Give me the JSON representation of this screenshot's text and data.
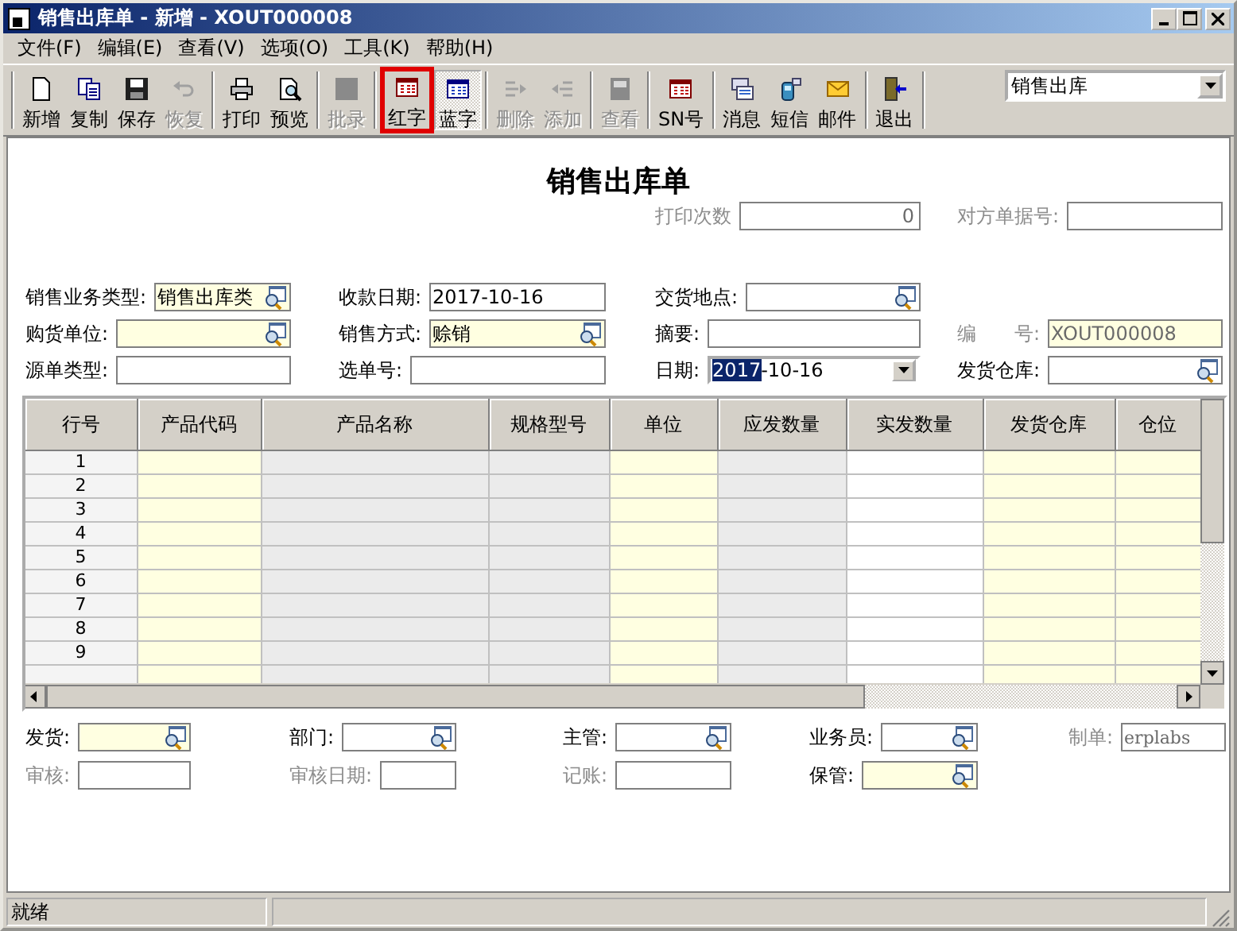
{
  "window": {
    "title": "销售出库单 - 新增 - XOUT000008"
  },
  "menu": [
    "文件(F)",
    "编辑(E)",
    "查看(V)",
    "选项(O)",
    "工具(K)",
    "帮助(H)"
  ],
  "toolbar": {
    "groups": [
      [
        {
          "label": "新增",
          "disabled": false,
          "pressed": false,
          "highlighted": false
        },
        {
          "label": "复制",
          "disabled": false,
          "pressed": false,
          "highlighted": false
        },
        {
          "label": "保存",
          "disabled": false,
          "pressed": false,
          "highlighted": false
        },
        {
          "label": "恢复",
          "disabled": true,
          "pressed": false,
          "highlighted": false
        }
      ],
      [
        {
          "label": "打印",
          "disabled": false,
          "pressed": false,
          "highlighted": false
        },
        {
          "label": "预览",
          "disabled": false,
          "pressed": false,
          "highlighted": false
        }
      ],
      [
        {
          "label": "批录",
          "disabled": true,
          "pressed": false,
          "highlighted": false
        }
      ],
      [
        {
          "label": "红字",
          "disabled": false,
          "pressed": false,
          "highlighted": true
        },
        {
          "label": "蓝字",
          "disabled": false,
          "pressed": true,
          "highlighted": false
        }
      ],
      [
        {
          "label": "删除",
          "disabled": true,
          "pressed": false,
          "highlighted": false
        },
        {
          "label": "添加",
          "disabled": true,
          "pressed": false,
          "highlighted": false
        }
      ],
      [
        {
          "label": "查看",
          "disabled": true,
          "pressed": false,
          "highlighted": false
        }
      ],
      [
        {
          "label": "SN号",
          "disabled": false,
          "pressed": false,
          "highlighted": false
        }
      ],
      [
        {
          "label": "消息",
          "disabled": false,
          "pressed": false,
          "highlighted": false
        },
        {
          "label": "短信",
          "disabled": false,
          "pressed": false,
          "highlighted": false
        },
        {
          "label": "邮件",
          "disabled": false,
          "pressed": false,
          "highlighted": false
        }
      ],
      [
        {
          "label": "退出",
          "disabled": false,
          "pressed": false,
          "highlighted": false
        }
      ]
    ],
    "combo": {
      "value": "销售出库"
    }
  },
  "document": {
    "title": "销售出库单",
    "print_info": [
      {
        "label": "打印次数",
        "value": "0",
        "kind": "number",
        "required": false,
        "disabled": true
      },
      {
        "label": "对方单据号:",
        "kind": "text",
        "required": false,
        "disabled": true
      }
    ],
    "fields": [
      [
        {
          "label": "销售业务类型:",
          "value": "销售出库类",
          "kind": "lookup",
          "required": true,
          "disabled": false
        },
        {
          "label": "收款日期:",
          "value": "2017-10-16",
          "kind": "text",
          "required": false,
          "disabled": false
        },
        {
          "label": "交货地点:",
          "kind": "lookup",
          "required": false,
          "disabled": false
        }
      ],
      [
        {
          "label": "购货单位:",
          "kind": "lookup",
          "required": true,
          "disabled": false
        },
        {
          "label": "销售方式:",
          "value": "赊销",
          "kind": "lookup",
          "required": true,
          "disabled": false
        },
        {
          "label": "摘要:",
          "kind": "text",
          "required": false,
          "disabled": false
        },
        {
          "label": "编　　号:",
          "value": "XOUT000008",
          "kind": "text",
          "required": true,
          "disabled": true
        }
      ],
      [
        {
          "label": "源单类型:",
          "kind": "text",
          "required": false,
          "disabled": false
        },
        {
          "label": "选单号:",
          "kind": "text",
          "required": false,
          "disabled": false
        },
        {
          "label": "日期:",
          "selected_text": "2017",
          "value": "-10-16",
          "kind": "date",
          "required": false,
          "disabled": false
        },
        {
          "label": "发货仓库:",
          "kind": "lookup",
          "required": false,
          "disabled": false
        }
      ]
    ]
  },
  "grid": {
    "columns": [
      {
        "label": "行号",
        "kind": "number"
      },
      {
        "label": "产品代码",
        "kind": "required"
      },
      {
        "label": "产品名称",
        "kind": "readonly"
      },
      {
        "label": "规格型号",
        "kind": "readonly"
      },
      {
        "label": "单位",
        "kind": "required"
      },
      {
        "label": "应发数量",
        "kind": "readonly"
      },
      {
        "label": "实发数量",
        "kind": "editable"
      },
      {
        "label": "发货仓库",
        "kind": "required"
      },
      {
        "label": "仓位",
        "kind": "required"
      }
    ],
    "rows": [
      {
        "number": "1"
      },
      {
        "number": "2"
      },
      {
        "number": "3"
      },
      {
        "number": "4"
      },
      {
        "number": "5"
      },
      {
        "number": "6"
      },
      {
        "number": "7"
      },
      {
        "number": "8"
      },
      {
        "number": "9"
      }
    ]
  },
  "footer_fields": [
    [
      {
        "label": "发货:",
        "kind": "lookup",
        "required": true,
        "disabled": false
      },
      {
        "label": "部门:",
        "kind": "lookup",
        "required": false,
        "disabled": false
      },
      {
        "label": "主管:",
        "kind": "lookup",
        "required": false,
        "disabled": false
      },
      {
        "label": "业务员:",
        "kind": "lookup",
        "required": false,
        "disabled": false
      },
      {
        "label": "制单:",
        "value": "erplabs",
        "kind": "text",
        "required": false,
        "disabled": true
      }
    ],
    [
      {
        "label": "审核:",
        "kind": "text",
        "required": false,
        "disabled": true
      },
      {
        "label": "审核日期:",
        "kind": "text",
        "required": false,
        "disabled": true
      },
      {
        "label": "记账:",
        "kind": "text",
        "required": false,
        "disabled": true
      },
      {
        "label": "保管:",
        "kind": "lookup",
        "required": true,
        "disabled": false
      }
    ]
  ],
  "status_bar": {
    "text": "就绪"
  }
}
